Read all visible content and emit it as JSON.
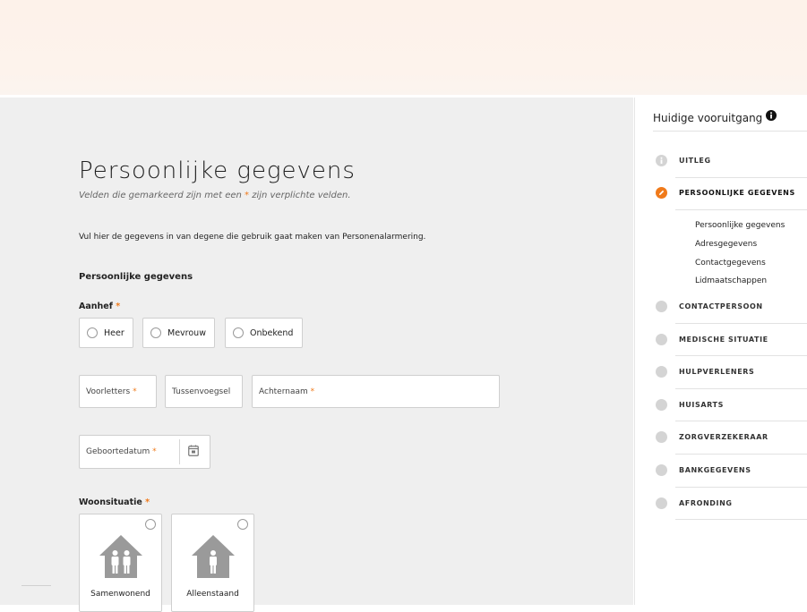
{
  "page": {
    "title": "Persoonlijke gegevens",
    "subtitle_before": "Velden die gemarkeerd zijn met een ",
    "subtitle_star": "*",
    "subtitle_after": " zijn verplichte velden.",
    "intro": "Vul hier de gegevens in van degene die gebruik gaat maken van Personenalarmering.",
    "section_heading": "Persoonlijke gegevens"
  },
  "form": {
    "required_marker": "*",
    "aanhef_label": "Aanhef",
    "aanhef_options": [
      "Heer",
      "Mevrouw",
      "Onbekend"
    ],
    "voorletters": "Voorletters",
    "tussenvoegsel": "Tussenvoegsel",
    "achternaam": "Achternaam",
    "geboortedatum": "Geboortedatum",
    "woonsituatie_label": "Woonsituatie",
    "woonsituatie_options": [
      "Samenwonend",
      "Alleenstaand"
    ]
  },
  "progress": {
    "title": "Huidige vooruitgang",
    "steps": [
      "UITLEG",
      "PERSOONLIJKE GEGEVENS",
      "CONTACTPERSOON",
      "MEDISCHE SITUATIE",
      "HULPVERLENERS",
      "HUISARTS",
      "ZORGVERZEKERAAR",
      "BANKGEGEVENS",
      "AFRONDING"
    ],
    "substeps": [
      "Persoonlijke gegevens",
      "Adresgegevens",
      "Contactgegevens",
      "Lidmaatschappen"
    ]
  },
  "colors": {
    "accent": "#f07a1a",
    "inactive_dot": "#d4d4d4",
    "background": "#efefef"
  },
  "icons": {
    "info": "info-icon",
    "done_step": "info-icon",
    "active_step": "pencil-icon",
    "calendar": "calendar-icon",
    "samenwonend": "house-two-people-icon",
    "alleenstaand": "house-one-person-icon"
  }
}
